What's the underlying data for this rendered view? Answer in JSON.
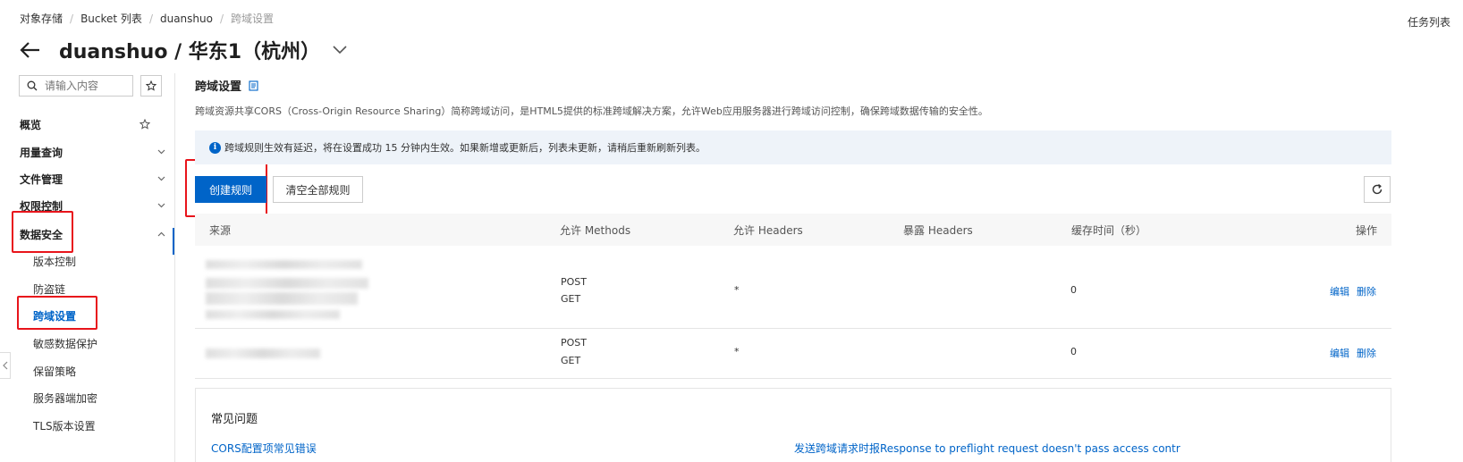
{
  "breadcrumb": [
    "对象存储",
    "Bucket 列表",
    "duanshuo",
    "跨域设置"
  ],
  "header": {
    "title": "duanshuo / 华东1（杭州）",
    "task_list": "任务列表"
  },
  "sidebar": {
    "search_placeholder": "请输入内容",
    "items": [
      {
        "label": "概览",
        "level": "top"
      },
      {
        "label": "用量查询",
        "level": "top"
      },
      {
        "label": "文件管理",
        "level": "top"
      },
      {
        "label": "权限控制",
        "level": "top"
      },
      {
        "label": "数据安全",
        "level": "top"
      },
      {
        "label": "版本控制",
        "level": "sub"
      },
      {
        "label": "防盗链",
        "level": "sub"
      },
      {
        "label": "跨域设置",
        "level": "sub",
        "active": true
      },
      {
        "label": "敏感数据保护",
        "level": "sub"
      },
      {
        "label": "保留策略",
        "level": "sub"
      },
      {
        "label": "服务器端加密",
        "level": "sub"
      },
      {
        "label": "TLS版本设置",
        "level": "sub"
      }
    ]
  },
  "main": {
    "section_title": "跨域设置",
    "description": "跨域资源共享CORS（Cross-Origin Resource Sharing）简称跨域访问，是HTML5提供的标准跨域解决方案，允许Web应用服务器进行跨域访问控制，确保跨域数据传输的安全性。",
    "notice": "跨域规则生效有延迟，将在设置成功 15 分钟内生效。如果新增或更新后，列表未更新，请稍后重新刷新列表。",
    "create_button": "创建规则",
    "clear_button": "清空全部规则",
    "table": {
      "headers": [
        "来源",
        "允许 Methods",
        "允许 Headers",
        "暴露 Headers",
        "缓存时间（秒）",
        "操作"
      ],
      "rows": [
        {
          "methods": [
            "POST",
            "GET"
          ],
          "allowed_headers": "*",
          "exposed_headers": "",
          "cache": "0",
          "edit": "编辑",
          "delete": "删除"
        },
        {
          "methods": [
            "POST",
            "GET"
          ],
          "allowed_headers": "*",
          "exposed_headers": "",
          "cache": "0",
          "edit": "编辑",
          "delete": "删除"
        }
      ]
    },
    "faq": {
      "title": "常见问题",
      "links": [
        "CORS配置项常见错误",
        "发送跨域请求时报Response to preflight request doesn't pass access contr"
      ]
    }
  },
  "colors": {
    "accent": "#0064c8",
    "highlight_box": "#e8141b"
  }
}
